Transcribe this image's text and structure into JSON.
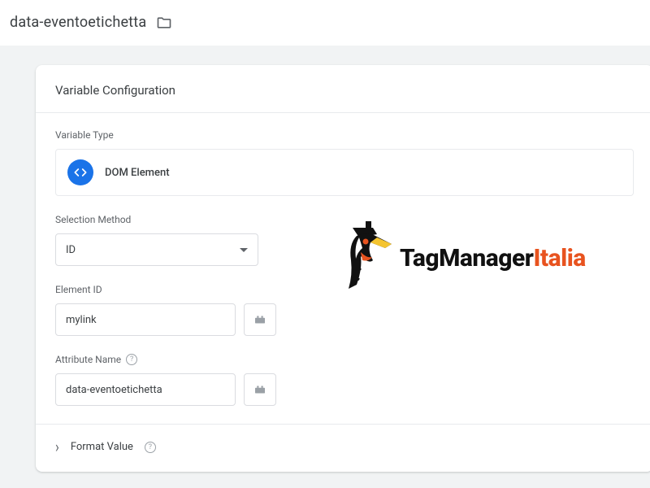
{
  "header": {
    "title": "data-eventoetichetta"
  },
  "card": {
    "heading": "Variable Configuration",
    "variable_type_label": "Variable Type",
    "variable_type_name": "DOM Element",
    "selection_method_label": "Selection Method",
    "selection_method_value": "ID",
    "element_id_label": "Element ID",
    "element_id_value": "mylink",
    "attribute_name_label": "Attribute Name",
    "attribute_name_value": "data-eventoetichetta",
    "format_value_label": "Format Value"
  },
  "brand": {
    "part1": "TagManager",
    "part2": "Italia"
  }
}
